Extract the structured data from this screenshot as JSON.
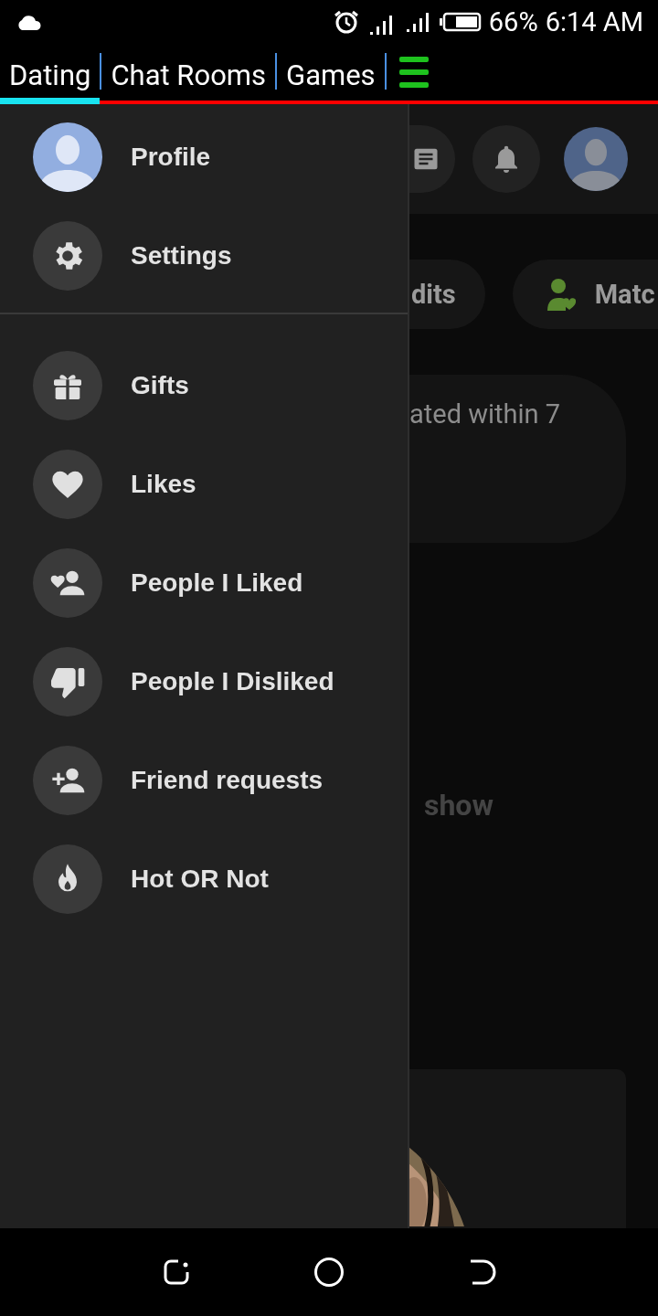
{
  "status_bar": {
    "battery": "66%",
    "time": "6:14 AM"
  },
  "tabs": [
    {
      "label": "Dating",
      "selected": true
    },
    {
      "label": "Chat Rooms",
      "selected": false
    },
    {
      "label": "Games",
      "selected": false
    }
  ],
  "drawer": {
    "sections": [
      [
        {
          "label": "Profile",
          "kind": "profile"
        },
        {
          "label": "Settings",
          "kind": "settings"
        }
      ],
      [
        {
          "label": "Gifts",
          "kind": "gifts"
        },
        {
          "label": "Likes",
          "kind": "likes"
        },
        {
          "label": "People I Liked",
          "kind": "liked"
        },
        {
          "label": "People I Disliked",
          "kind": "disliked"
        },
        {
          "label": "Friend requests",
          "kind": "friend"
        },
        {
          "label": "Hot OR Not",
          "kind": "hot"
        }
      ]
    ]
  },
  "main": {
    "chips": [
      {
        "label": "dits",
        "kind": "plain"
      },
      {
        "label": "Matc",
        "kind": "match"
      }
    ],
    "notice": "ated within 7",
    "empty_text": "show"
  }
}
